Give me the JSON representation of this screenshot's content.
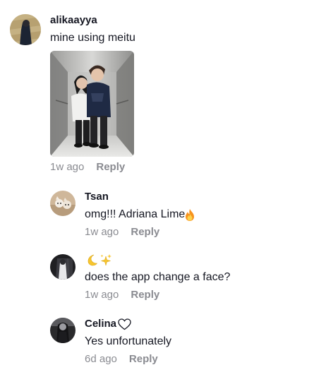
{
  "comments": [
    {
      "username": "alikaayya",
      "text": "mine using meitu",
      "time": "1w ago",
      "reply_label": "Reply",
      "avatar_icon": "user-avatar",
      "attachment": "photo-couple-in-elevator",
      "replies": [
        {
          "username": "Tsan",
          "text": "omg!!! Adriana Lime",
          "text_emoji": "fire-emoji",
          "time": "1w ago",
          "reply_label": "Reply",
          "avatar_icon": "user-avatar"
        },
        {
          "username": "",
          "username_emojis": [
            "crescent-moon-emoji",
            "sparkles-emoji"
          ],
          "text": "does the app change a face?",
          "time": "1w ago",
          "reply_label": "Reply",
          "avatar_icon": "user-avatar"
        },
        {
          "username": "Celina",
          "username_emoji": "white-heart-emoji",
          "text": "Yes unfortunately",
          "time": "6d ago",
          "reply_label": "Reply",
          "avatar_icon": "user-avatar"
        }
      ]
    }
  ]
}
